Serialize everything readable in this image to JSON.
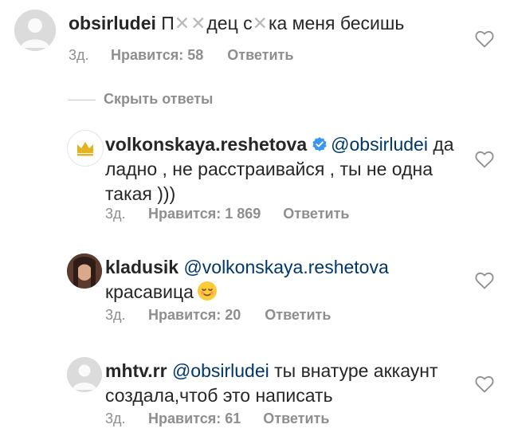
{
  "comments": [
    {
      "username": "obsirludei",
      "text_part1": "П",
      "text_censor1": "✕✕",
      "text_part2": "дец с",
      "text_censor2": "✕",
      "text_part3": "ка меня бесишь",
      "time": "3д.",
      "likes": "Нравится: 58",
      "reply": "Ответить"
    },
    {
      "username": "volkonskaya.reshetova",
      "mention": "@obsirludei",
      "text_inline": "да",
      "text_line2": "ладно , не расстраивайся , ты не одна",
      "text_line3": "такая )))",
      "time": "3д.",
      "likes": "Нравится: 1 869",
      "reply": "Ответить"
    },
    {
      "username": "kladusik",
      "mention": "@volkonskaya.reshetova",
      "text_line2": "красавица",
      "time": "3д.",
      "likes": "Нравится: 20",
      "reply": "Ответить"
    },
    {
      "username": "mhtv.rr",
      "mention": "@obsirludei",
      "text_inline": "ты внатуре аккаунт",
      "text_line2": "создала,чтоб это написать",
      "time": "3д.",
      "likes": "Нравится: 61",
      "reply": "Ответить"
    }
  ],
  "hide_replies": "Скрыть ответы",
  "colors": {
    "text": "#262626",
    "meta": "#8e8e8e",
    "mention": "#00376b",
    "verified": "#3897f0"
  }
}
